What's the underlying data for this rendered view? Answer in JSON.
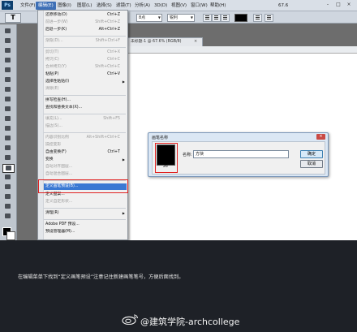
{
  "menubar": {
    "logo": "Ps",
    "items": [
      "文件(F)",
      "编辑(E)",
      "图像(I)",
      "图层(L)",
      "选择(S)",
      "滤镜(T)",
      "分析(A)",
      "3D(D)",
      "视图(V)",
      "窗口(W)",
      "帮助(H)"
    ],
    "active_index": 1,
    "zoom": "67.6",
    "window_controls": [
      "-",
      "□",
      "×"
    ]
  },
  "options_bar": {
    "tool_icon": "type-tool-icon",
    "tool_glyph": "T",
    "font_size": "8点",
    "antialias": "锐利"
  },
  "document_tab": {
    "title": "未标题-1 @ 67.6% (RGB/8)",
    "close": "×"
  },
  "edit_menu": {
    "items": [
      {
        "label": "还原移动(O)",
        "shortcut": "Ctrl+Z",
        "disabled": false
      },
      {
        "label": "前进一步(W)",
        "shortcut": "Shift+Ctrl+Z",
        "disabled": true
      },
      {
        "label": "后退一步(K)",
        "shortcut": "Alt+Ctrl+Z",
        "disabled": false
      },
      {
        "label": "渐隐(D)...",
        "shortcut": "Shift+Ctrl+F",
        "disabled": true
      },
      {
        "label": "剪切(T)",
        "shortcut": "Ctrl+X",
        "disabled": true
      },
      {
        "label": "拷贝(C)",
        "shortcut": "Ctrl+C",
        "disabled": true
      },
      {
        "label": "合并拷贝(Y)",
        "shortcut": "Shift+Ctrl+C",
        "disabled": true
      },
      {
        "label": "粘贴(P)",
        "shortcut": "Ctrl+V",
        "disabled": false
      },
      {
        "label": "选择性粘贴(I)",
        "shortcut": "",
        "disabled": false,
        "submenu": true
      },
      {
        "label": "清除(E)",
        "shortcut": "",
        "disabled": true
      },
      {
        "label": "拼写检查(H)...",
        "shortcut": "",
        "disabled": false
      },
      {
        "label": "查找和替换文本(X)...",
        "shortcut": "",
        "disabled": false
      },
      {
        "label": "填充(L)...",
        "shortcut": "Shift+F5",
        "disabled": true
      },
      {
        "label": "描边(S)...",
        "shortcut": "",
        "disabled": true
      },
      {
        "label": "内容识别比例",
        "shortcut": "Alt+Shift+Ctrl+C",
        "disabled": true
      },
      {
        "label": "操控变形",
        "shortcut": "",
        "disabled": true
      },
      {
        "label": "自由变换(F)",
        "shortcut": "Ctrl+T",
        "disabled": false
      },
      {
        "label": "变换",
        "shortcut": "",
        "disabled": false,
        "submenu": true
      },
      {
        "label": "自动对齐图层...",
        "shortcut": "",
        "disabled": true
      },
      {
        "label": "自动混合图层...",
        "shortcut": "",
        "disabled": true
      },
      {
        "label": "定义画笔预设(B)...",
        "shortcut": "",
        "disabled": false,
        "highlight": true
      },
      {
        "label": "定义图案...",
        "shortcut": "",
        "disabled": false
      },
      {
        "label": "定义自定形状...",
        "shortcut": "",
        "disabled": true
      },
      {
        "label": "清理(R)",
        "shortcut": "",
        "disabled": false,
        "submenu": true
      },
      {
        "label": "Adobe PDF 预设...",
        "shortcut": "",
        "disabled": false
      },
      {
        "label": "预设管理器(M)...",
        "shortcut": "",
        "disabled": false
      }
    ]
  },
  "dialog": {
    "title": "画笔名称",
    "close": "×",
    "brush_size": "26",
    "name_label": "名称:",
    "name_value": "方块",
    "ok_label": "确定",
    "cancel_label": "取消"
  },
  "caption": {
    "text": "在编辑菜单下找到“定义画笔预设”注意记住新建画笔笔号，方便后面找到。"
  },
  "watermark": {
    "text": "@建筑学院-archcollege"
  }
}
